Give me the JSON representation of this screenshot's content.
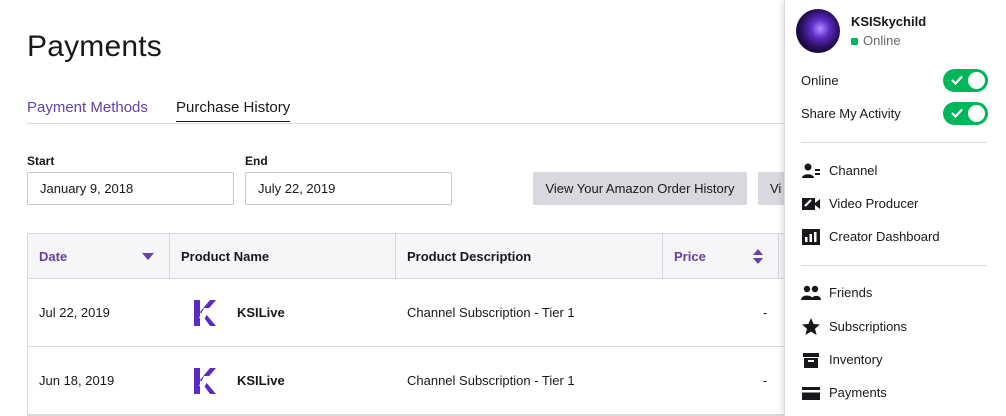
{
  "page": {
    "title": "Payments"
  },
  "tabs": [
    {
      "label": "Payment Methods"
    },
    {
      "label": "Purchase History"
    }
  ],
  "filters": {
    "start_label": "Start",
    "start_value": "January 9, 2018",
    "end_label": "End",
    "end_value": "July 22, 2019",
    "amazon_button": "View Your Amazon Order History",
    "second_button": "Vi"
  },
  "table": {
    "headers": [
      "Date",
      "Product Name",
      "Product Description",
      "Price"
    ],
    "rows": [
      {
        "date": "Jul 22, 2019",
        "product": "KSILive",
        "description": "Channel Subscription - Tier 1",
        "price": "-"
      },
      {
        "date": "Jun 18, 2019",
        "product": "KSILive",
        "description": "Channel Subscription - Tier 1",
        "price": "-"
      }
    ]
  },
  "user": {
    "name": "KSISkychild",
    "status": "Online"
  },
  "toggles": [
    {
      "label": "Online",
      "on": true
    },
    {
      "label": "Share My Activity",
      "on": true
    }
  ],
  "menu": {
    "group1": [
      {
        "label": "Channel",
        "icon": "channel-icon"
      },
      {
        "label": "Video Producer",
        "icon": "video-producer-icon"
      },
      {
        "label": "Creator Dashboard",
        "icon": "dashboard-icon"
      }
    ],
    "group2": [
      {
        "label": "Friends",
        "icon": "friends-icon"
      },
      {
        "label": "Subscriptions",
        "icon": "star-icon"
      },
      {
        "label": "Inventory",
        "icon": "inventory-icon"
      },
      {
        "label": "Payments",
        "icon": "credit-card-icon"
      }
    ]
  },
  "colors": {
    "accent": "#6441a4",
    "online": "#00b65a",
    "button_bg": "#dad8de"
  }
}
